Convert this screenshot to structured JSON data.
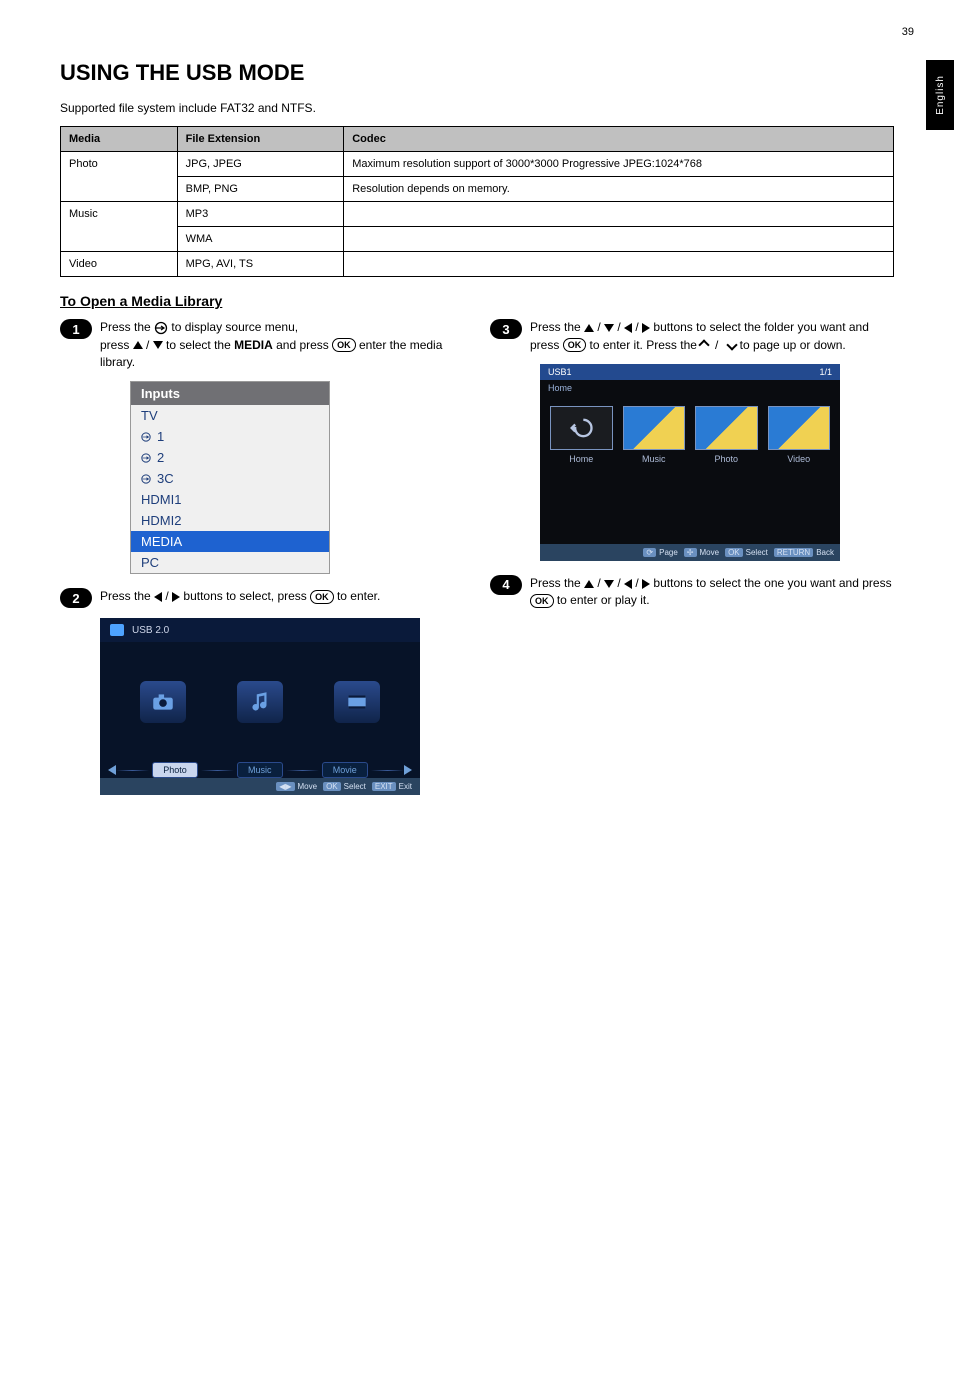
{
  "page": {
    "number": "39",
    "side_tab": "English",
    "title": "USING THE USB MODE",
    "intro": "Supported file system include FAT32 and NTFS.",
    "table": {
      "headers": [
        "Media",
        "File Extension",
        "Codec"
      ],
      "rows": [
        {
          "media": "Photo",
          "cells": [
            {
              "ext": "JPG, JPEG",
              "codec": "Maximum resolution support of 3000*3000 Progressive JPEG:1024*768"
            },
            {
              "ext": "BMP, PNG",
              "codec": "Resolution depends on memory."
            }
          ]
        },
        {
          "media": "Music",
          "cells": [
            {
              "ext": "MP3",
              "codec": ""
            },
            {
              "ext": "WMA",
              "codec": ""
            }
          ]
        },
        {
          "media": "Video",
          "cells": [
            {
              "ext": "MPG, AVI, TS",
              "codec": ""
            }
          ]
        }
      ]
    },
    "subhead": "To Open a Media Library",
    "steps": [
      {
        "n": "1",
        "html_parts": [
          "Press the ",
          " to display source menu,",
          "press ",
          " to select the ",
          "MEDIA",
          " and press ",
          " enter the media library."
        ]
      },
      {
        "n": "2",
        "html_parts": [
          "Press the ",
          " buttons to select, press ",
          " to enter."
        ]
      },
      {
        "n": "3",
        "html_parts": [
          "Press the ",
          " buttons to select the folder you want and press ",
          " to enter it.",
          " Press the ",
          " to page up or down."
        ]
      },
      {
        "n": "4",
        "html_parts": [
          "Press the ",
          " buttons to select the one you want and press ",
          " to enter or play it."
        ]
      }
    ],
    "inputs_menu": {
      "title": "Inputs",
      "items": [
        "TV",
        "1",
        "2",
        "3C",
        "HDMI1",
        "HDMI2",
        "MEDIA",
        "PC"
      ],
      "selected": "MEDIA"
    },
    "media1": {
      "device": "USB 2.0",
      "tabs": [
        "Photo",
        "Music",
        "Movie"
      ],
      "selected": "Photo",
      "legend": [
        [
          "",
          "Move"
        ],
        [
          "OK",
          "Select"
        ],
        [
          "EXIT",
          "Exit"
        ]
      ]
    },
    "media2": {
      "title": "USB1",
      "page": "1/1",
      "breadcrumb": "Home",
      "tiles": [
        "Home",
        "Music",
        "Photo",
        "Video"
      ],
      "legend": [
        [
          "",
          "Page"
        ],
        [
          "",
          "Move"
        ],
        [
          "OK",
          "Select"
        ],
        [
          "RETURN",
          "Back"
        ]
      ]
    }
  }
}
